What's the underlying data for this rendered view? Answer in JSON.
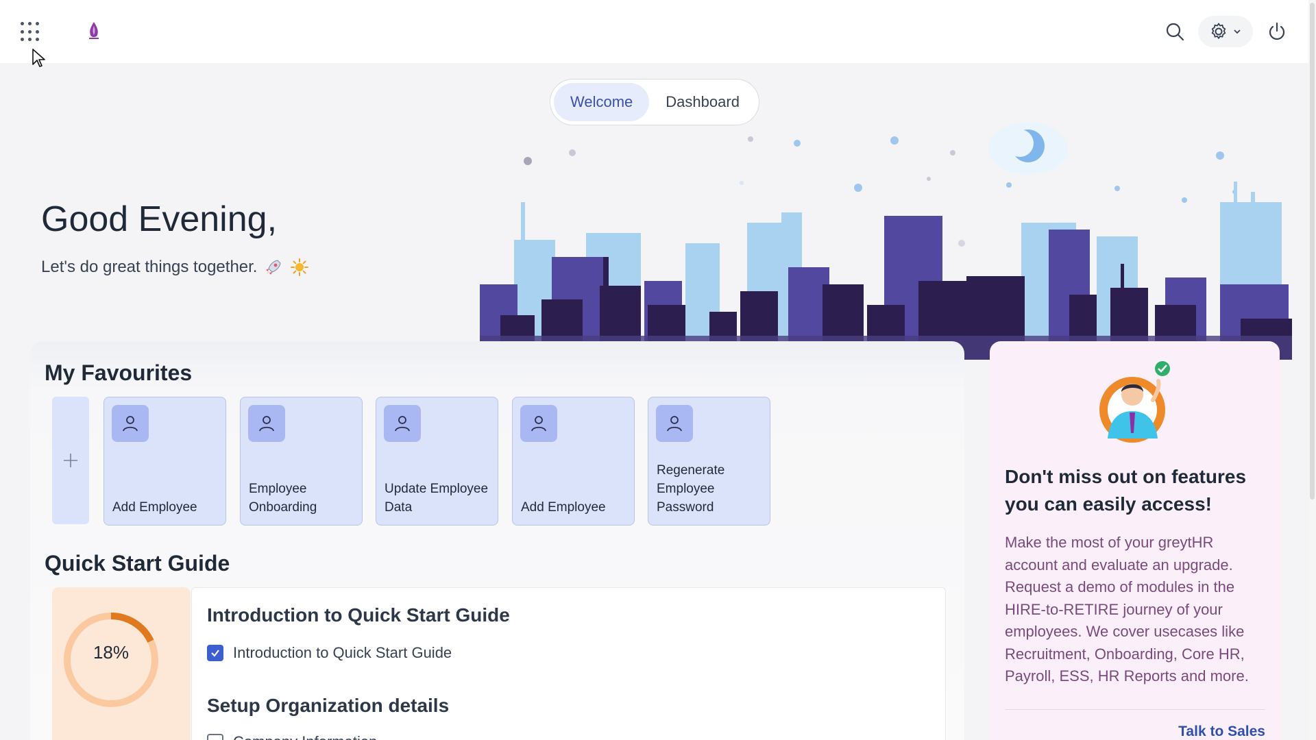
{
  "header": {
    "apps_icon": "apps-grid-icon",
    "logo_icon": "company-logo-icon",
    "search_icon": "search-icon",
    "settings_icon": "gear-icon",
    "power_icon": "power-icon"
  },
  "tabs": [
    {
      "label": "Welcome",
      "active": true
    },
    {
      "label": "Dashboard",
      "active": false
    }
  ],
  "hero": {
    "greeting": "Good Evening,",
    "tagline": "Let's do great things together."
  },
  "favourites": {
    "title": "My Favourites",
    "add_icon": "plus-icon",
    "items": [
      {
        "label": "Add Employee",
        "icon": "user-icon"
      },
      {
        "label": "Employee Onboarding",
        "icon": "user-icon"
      },
      {
        "label": "Update Employee Data",
        "icon": "user-icon"
      },
      {
        "label": "Add Employee",
        "icon": "user-icon"
      },
      {
        "label": "Regenerate Employee Password",
        "icon": "user-icon"
      }
    ]
  },
  "quick_start": {
    "title": "Quick Start Guide",
    "progress_label": "18%",
    "progress_value": 0.18,
    "sections": [
      {
        "heading": "Introduction to Quick Start Guide",
        "items": [
          {
            "label": "Introduction to Quick Start Guide",
            "checked": true
          }
        ]
      },
      {
        "heading": "Setup Organization details",
        "items": [
          {
            "label": "Company Information",
            "checked": false
          }
        ]
      }
    ]
  },
  "promo": {
    "heading": "Don't miss out on features you can easily access!",
    "body": "Make the most of your greytHR account and evaluate an upgrade. Request a demo of modules in the HIRE-to-RETIRE journey of your employees. We cover usecases like Recruitment, Onboarding, Core HR, Payroll, ESS, HR Reports and more.",
    "link": "Talk to Sales"
  },
  "colors": {
    "accent": "#3b50a8",
    "fav_card": "#dbe3fb",
    "progress_track": "#fbc9a0",
    "progress_fill": "#e07a1f",
    "promo_bg": "#fbf0fa",
    "promo_text": "#7a4a7a"
  }
}
